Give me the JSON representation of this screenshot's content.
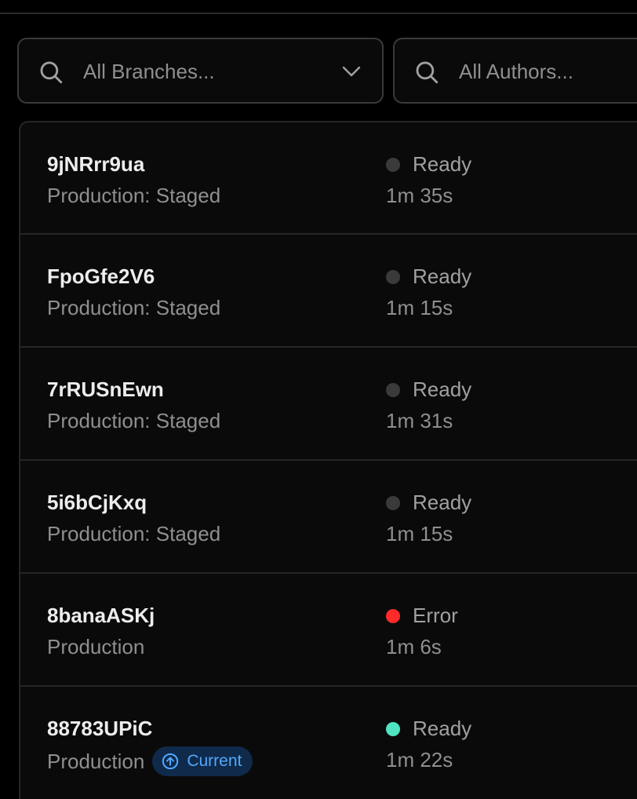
{
  "filters": {
    "branches": {
      "placeholder": "All Branches...",
      "icon": "search-icon",
      "dropdown_icon": "chevron-down-icon"
    },
    "authors": {
      "placeholder": "All Authors...",
      "icon": "search-icon"
    }
  },
  "status_colors": {
    "ready": "#3a3a3a",
    "error": "#ff2b2b",
    "ready_current": "#50e3c2"
  },
  "deployments": [
    {
      "id": "9jNRrr9ua",
      "environment": "Production: Staged",
      "status": "Ready",
      "status_kind": "ready",
      "duration": "1m 35s"
    },
    {
      "id": "FpoGfe2V6",
      "environment": "Production: Staged",
      "status": "Ready",
      "status_kind": "ready",
      "duration": "1m 15s"
    },
    {
      "id": "7rRUSnEwn",
      "environment": "Production: Staged",
      "status": "Ready",
      "status_kind": "ready",
      "duration": "1m 31s"
    },
    {
      "id": "5i6bCjKxq",
      "environment": "Production: Staged",
      "status": "Ready",
      "status_kind": "ready",
      "duration": "1m 15s"
    },
    {
      "id": "8banaASKj",
      "environment": "Production",
      "status": "Error",
      "status_kind": "error",
      "duration": "1m 6s"
    },
    {
      "id": "88783UPiC",
      "environment": "Production",
      "status": "Ready",
      "status_kind": "ready_current",
      "duration": "1m 22s",
      "badge": "Current"
    }
  ]
}
